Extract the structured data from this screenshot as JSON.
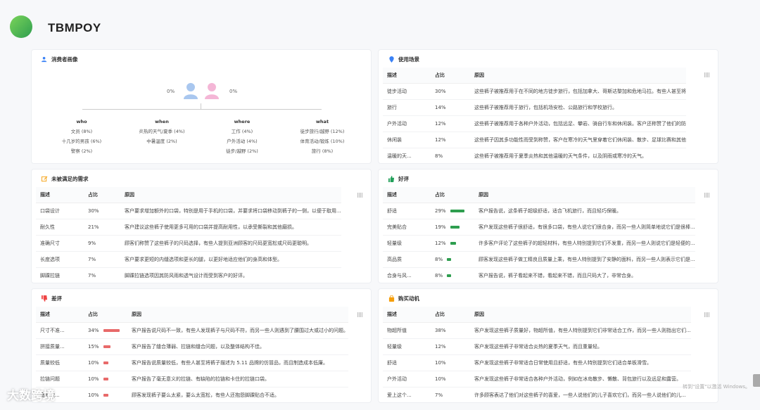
{
  "brand": "TBMPOY",
  "persona": {
    "title": "消费者画像",
    "male_pct": "0%",
    "female_pct": "0%",
    "columns": [
      {
        "head": "who",
        "items": [
          "文员 (8%)",
          "十几岁的男孩 (6%)",
          "警察 (2%)"
        ]
      },
      {
        "head": "when",
        "items": [
          "炎热的天气/夏季 (4%)",
          "中暑温度 (2%)"
        ]
      },
      {
        "head": "where",
        "items": [
          "工作 (4%)",
          "户外活动 (4%)",
          "徒步/越野 (2%)"
        ]
      },
      {
        "head": "what",
        "items": [
          "徒步旅行/越野 (12%)",
          "体育活动/锻炼 (10%)",
          "旅行 (8%)"
        ]
      }
    ]
  },
  "scenes": {
    "title": "使用场景",
    "headers": [
      "描述",
      "占比",
      "原因"
    ],
    "rows": [
      [
        "徒步活动",
        "30%",
        "这些裤子被推荐用于在不同的地方徒步旅行，包括加拿大、哥斯达黎加和危地马拉。有些人甚至将"
      ],
      [
        "旅行",
        "14%",
        "这些裤子被推荐用于旅行，包括机场安检、公路旅行和学校旅行。"
      ],
      [
        "户外活动",
        "12%",
        "这些裤子被推荐用于各种户外活动，包括远足、攀岩、骑自行车和休闲装。客户还称赞了他们的防"
      ],
      [
        "休闲装",
        "12%",
        "这些裤子因其多功能性而受到称赞，客户在寒冷的天气里穿着它们休闲装、散步、足球比赛和其他"
      ],
      [
        "温暖的天...",
        "8%",
        "这些裤子被推荐用于夏季炎热和其他温暖的天气条件，以及阴雨或寒冷的天气。"
      ]
    ]
  },
  "unmet": {
    "title": "未被满足的需求",
    "headers": [
      "描述",
      "占比",
      "原因"
    ],
    "rows": [
      [
        "口袋设计",
        "30%",
        "客户要求增加额外的口袋，特别是用于手机的口袋，并要求将口袋移动到裤子的一侧，以便于取用..."
      ],
      [
        "耐久性",
        "21%",
        "客户建议这些裤子使用更多可用的口袋并提高耐用性，以承受撕裂和其他磨损。"
      ],
      [
        "准确尺寸",
        "9%",
        "顾客们称赞了这些裤子的尺码选择，有些人提到亚洲顾客的尺码更宽松或尺码更聪明。"
      ],
      [
        "长度选项",
        "7%",
        "客户要求更短的内缝选项和更长的腿，以更好地适应他们的身高和体型。"
      ],
      [
        "脚踝拉链",
        "7%",
        "脚踝拉链选项因其防风雨和透气设计而受到客户的好评。"
      ]
    ]
  },
  "praise": {
    "title": "好评",
    "headers": [
      "描述",
      "占比",
      "原因"
    ],
    "rows": [
      {
        "d": "舒适",
        "p": "29%",
        "v": 29,
        "r": "客户报告说，这条裤子超级舒适，适合飞机旅行，而且轻巧保暖。"
      },
      {
        "d": "完美贴合",
        "p": "19%",
        "v": 19,
        "r": "客户发现这些裤子很舒适，有很多口袋，有些人说它们很合身，而另一些人则简单地说它们是很棒..."
      },
      {
        "d": "轻量级",
        "p": "12%",
        "v": 12,
        "r": "许多客户评论了这些裤子的超轻材料，有些人特别提到它们不发重，而另一些人则说它们是轻便的..."
      },
      {
        "d": "高品质",
        "p": "8%",
        "v": 8,
        "r": "顾客发现这些裤子做工精良且质量上乘，有些人特别提到了安静的面料，而另一些人则表示它们是..."
      },
      {
        "d": "合身与风...",
        "p": "8%",
        "v": 8,
        "r": "客户报告说，裤子看起来不错，看起来不错，而且尺码大了，非常合身。"
      }
    ]
  },
  "bad": {
    "title": "差评",
    "headers": [
      "描述",
      "占比",
      "原因"
    ],
    "rows": [
      {
        "d": "尺寸不准...",
        "p": "34%",
        "v": 34,
        "r": "客户报告说尺码不一致，有些人发现裤子与尺码不符，而另一些人则遇到了腰围过大或过小的问题。"
      },
      {
        "d": "拼接质量...",
        "p": "15%",
        "v": 15,
        "r": "客户报告了缝合薄弱、拉链和缝合问题，以及整体结构不佳。"
      },
      {
        "d": "质量较低",
        "p": "10%",
        "v": 10,
        "r": "客户报告说质量较低，有些人甚至将裤子描述为 5.11 品牌的仿冒品，而且制造成本低廉。"
      },
      {
        "d": "拉链问题",
        "p": "10%",
        "v": 10,
        "r": "客户报告了毫无意义的拉链、有缺陷的拉链和卡住的拉链口袋。"
      },
      {
        "d": "宽松款...",
        "p": "10%",
        "v": 10,
        "r": "顾客发现裤子要么太紧，要么太宽松，有些人还抱怨脚踝贴合不适。"
      }
    ]
  },
  "motive": {
    "title": "购买动机",
    "headers": [
      "描述",
      "占比",
      "原因"
    ],
    "rows": [
      [
        "物超所值",
        "38%",
        "客户发现这些裤子质量好，物超所值，有些人特别提到它们非常适合工作，而另一些人则指出它们..."
      ],
      [
        "轻量级",
        "12%",
        "客户发现这些裤子非常适合炎热的夏季天气，而且重量轻。"
      ],
      [
        "舒适",
        "10%",
        "客户发现这些裤子非常适合日常使用且舒适，有些人特别提到它们适合单板滑雪。"
      ],
      [
        "户外活动",
        "10%",
        "客户发现这些裤子非常适合各种户外活动，例如在冰岛散步、懒散、背包旅行以及远足和露营。"
      ],
      [
        "爱上这个...",
        "7%",
        "许多顾客表达了他们对这些裤子的喜爱，一些人说他们的儿子喜欢它们，而另一些人说他们的儿..."
      ]
    ]
  },
  "footer_brand": "大数跨境",
  "watermark": "转到\"设置\"以激活 Windows。"
}
